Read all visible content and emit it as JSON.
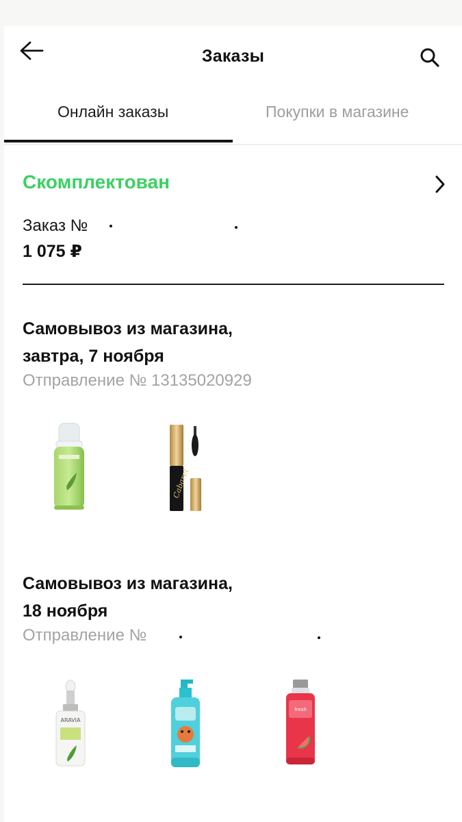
{
  "header": {
    "title": "Заказы",
    "back_icon": "arrow-left-icon",
    "search_icon": "search-icon"
  },
  "tabs": [
    {
      "label": "Онлайн заказы",
      "active": true
    },
    {
      "label": "Покупки в магазине",
      "active": false
    }
  ],
  "order": {
    "status": "Скомплектован",
    "status_color": "#3bd163",
    "number_label": "Заказ №",
    "total": "1 075 ₽",
    "chevron_icon": "chevron-right-icon"
  },
  "shipments": [
    {
      "title_line1": "Самовывоз из магазина,",
      "title_line2": "завтра, 7 ноября",
      "shipment_number": "Отправление № 13135020929",
      "products": [
        "foam-cleanser-image",
        "mascara-image"
      ]
    },
    {
      "title_line1": "Самовывоз из магазина,",
      "title_line2": "18 ноября",
      "shipment_number": "Отправление №",
      "products": [
        "serum-bottle-image",
        "shampoo-bottle-image",
        "red-bottle-image"
      ]
    }
  ]
}
